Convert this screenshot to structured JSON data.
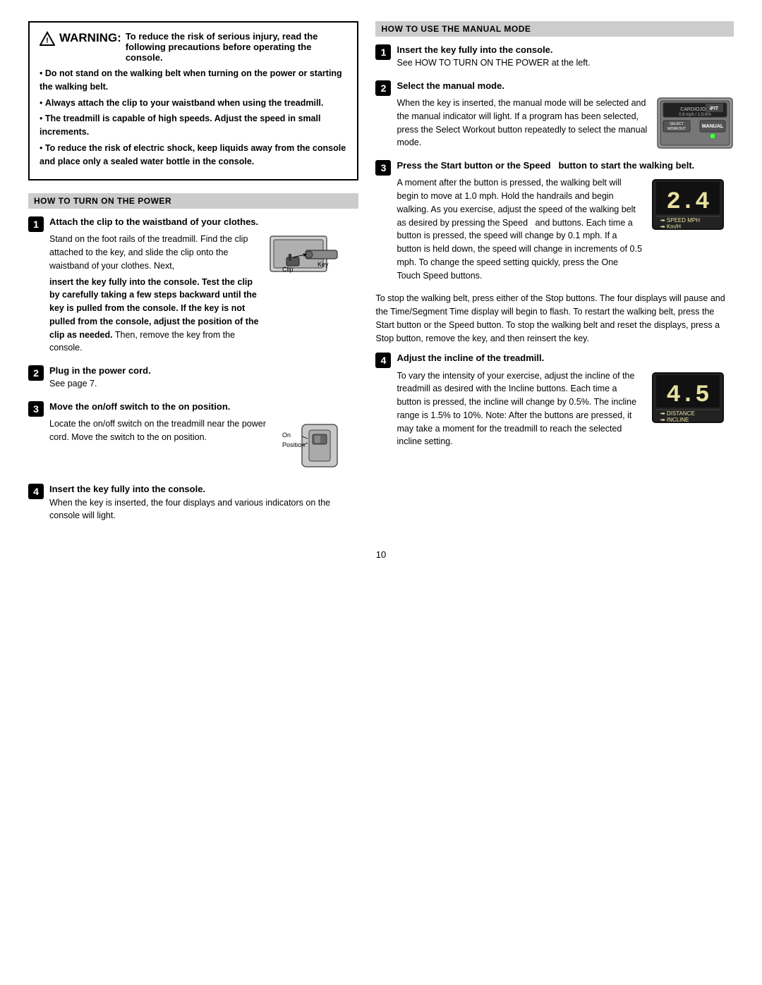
{
  "warning": {
    "title": "WARNING:",
    "subtitle": " To reduce the risk of serious injury, read the following precautions before operating the console.",
    "bullets": [
      "Do not stand on the walking belt when turning on the power or starting the walking belt.",
      "Always attach the clip to your waistband when using the treadmill.",
      "The treadmill is capable of high speeds. Adjust the speed in small increments.",
      "To reduce the risk of electric shock, keep liquids away from the console and place only a sealed water bottle in the console."
    ]
  },
  "left_section": {
    "header": "HOW TO TURN ON THE POWER",
    "steps": [
      {
        "number": "1",
        "title": "Attach the clip to the waistband of your clothes.",
        "text_before": "Stand on the foot rails of the treadmill. Find the clip attached to the key, and slide the clip onto the waistband of your clothes. Next,",
        "text_bold": "insert the key fully into the console. Test the clip by carefully taking a few steps backward until the key is pulled from the console. If the key is not pulled from the console, adjust the position of the clip as needed.",
        "text_after": "Then, remove the key from the console.",
        "clip_label": "Clip",
        "key_label": "Key"
      },
      {
        "number": "2",
        "title": "Plug in the power cord.",
        "text": "See page 7."
      },
      {
        "number": "3",
        "title": "Move the on/off switch to the on position.",
        "text": "Locate the on/off switch on the treadmill near the power cord. Move the switch to the on position.",
        "on_label": "On",
        "position_label": "Position"
      },
      {
        "number": "4",
        "title": "Insert the key fully into the console.",
        "text": "When the key is inserted, the four displays and various indicators on the console will light."
      }
    ]
  },
  "right_section": {
    "header": "HOW TO USE THE MANUAL MODE",
    "steps": [
      {
        "number": "1",
        "title": "Insert the key fully into the console.",
        "text": "See HOW TO TURN ON THE POWER at the left."
      },
      {
        "number": "2",
        "title": "Select the manual mode.",
        "text_parts": [
          "When the key is inserted, the manual mode will be selected and the manual indicator will light. If a program has been selected, press the Select Workout button repeatedly to select the manual mode."
        ],
        "console_labels": {
          "cardio": "CARDIOJOG",
          "icon": "iFIT",
          "select": "SELECT\nWORKOUT",
          "manual": "MANUAL"
        }
      },
      {
        "number": "3",
        "title": "Press the Start button or the Speed",
        "title2": "button to start the walking belt.",
        "text": "A moment after the button is pressed, the walking belt will begin to move at 1.0 mph. Hold the handrails and begin walking. As you exercise, adjust the speed of the walking belt as desired by pressing the Speed    and buttons. Each time a button is pressed, the speed will change by 0.1 mph. If a button is held down, the speed will change in increments of 0.5 mph. To change the speed setting quickly, press the One Touch Speed buttons.",
        "display_value": "2.4",
        "display_labels": [
          "SPEED MPH",
          "Km/H"
        ]
      },
      {
        "number": "4",
        "title": "Adjust the incline of the treadmill.",
        "text": "To vary the intensity of your exercise, adjust the incline of the treadmill as desired with the Incline buttons. Each time a button is pressed, the incline will change by 0.5%. The incline range is 1.5% to 10%. Note: After the buttons are pressed, it may take a moment for the treadmill to reach the selected incline setting.",
        "display_value": "4.5",
        "display_labels": [
          "DISTANCE",
          "INCLINE"
        ]
      }
    ],
    "stop_text": "To stop the walking belt, press either of the Stop buttons. The four displays will pause and the Time/Segment Time display will begin to flash. To restart the walking belt, press the Start button or the Speed    button. To stop the walking belt and reset the displays, press a Stop button, remove the key, and then reinsert the key."
  },
  "page_number": "10"
}
